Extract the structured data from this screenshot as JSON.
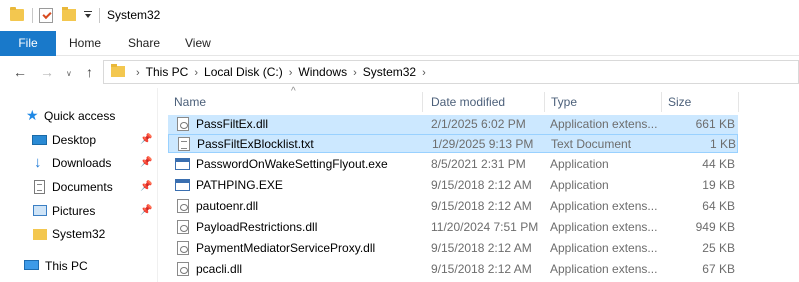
{
  "window": {
    "title": "System32"
  },
  "ribbon": {
    "tabs": [
      "File",
      "Home",
      "Share",
      "View"
    ]
  },
  "nav": {
    "back": "←",
    "forward": "→",
    "recent": "∨",
    "up": "↑"
  },
  "address": {
    "crumbs": [
      "This PC",
      "Local Disk (C:)",
      "Windows",
      "System32"
    ],
    "separator": "›"
  },
  "sidebar": {
    "quick_access": "Quick access",
    "items": [
      {
        "label": "Desktop",
        "icon": "desktop-icon",
        "pinned": true
      },
      {
        "label": "Downloads",
        "icon": "download-icon",
        "pinned": true
      },
      {
        "label": "Documents",
        "icon": "documents-icon",
        "pinned": true
      },
      {
        "label": "Pictures",
        "icon": "pictures-icon",
        "pinned": true
      },
      {
        "label": "System32",
        "icon": "folder-icon",
        "pinned": false
      }
    ],
    "this_pc": "This PC",
    "pin_glyph": "📌"
  },
  "columns": {
    "name": "Name",
    "date": "Date modified",
    "type": "Type",
    "size": "Size",
    "sort_glyph": "^"
  },
  "files": [
    {
      "name": "PassFiltEx.dll",
      "date": "2/1/2025 6:02 PM",
      "type": "Application extens...",
      "size": "661 KB",
      "kind": "dll",
      "state": "selected"
    },
    {
      "name": "PassFiltExBlocklist.txt",
      "date": "1/29/2025 9:13 PM",
      "type": "Text Document",
      "size": "1 KB",
      "kind": "txt",
      "state": "focused"
    },
    {
      "name": "PasswordOnWakeSettingFlyout.exe",
      "date": "8/5/2021 2:31 PM",
      "type": "Application",
      "size": "44 KB",
      "kind": "exe",
      "state": ""
    },
    {
      "name": "PATHPING.EXE",
      "date": "9/15/2018 2:12 AM",
      "type": "Application",
      "size": "19 KB",
      "kind": "exe",
      "state": ""
    },
    {
      "name": "pautoenr.dll",
      "date": "9/15/2018 2:12 AM",
      "type": "Application extens...",
      "size": "64 KB",
      "kind": "dll",
      "state": ""
    },
    {
      "name": "PayloadRestrictions.dll",
      "date": "11/20/2024 7:51 PM",
      "type": "Application extens...",
      "size": "949 KB",
      "kind": "dll",
      "state": ""
    },
    {
      "name": "PaymentMediatorServiceProxy.dll",
      "date": "9/15/2018 2:12 AM",
      "type": "Application extens...",
      "size": "25 KB",
      "kind": "dll",
      "state": ""
    },
    {
      "name": "pcacli.dll",
      "date": "9/15/2018 2:12 AM",
      "type": "Application extens...",
      "size": "67 KB",
      "kind": "dll",
      "state": ""
    }
  ]
}
